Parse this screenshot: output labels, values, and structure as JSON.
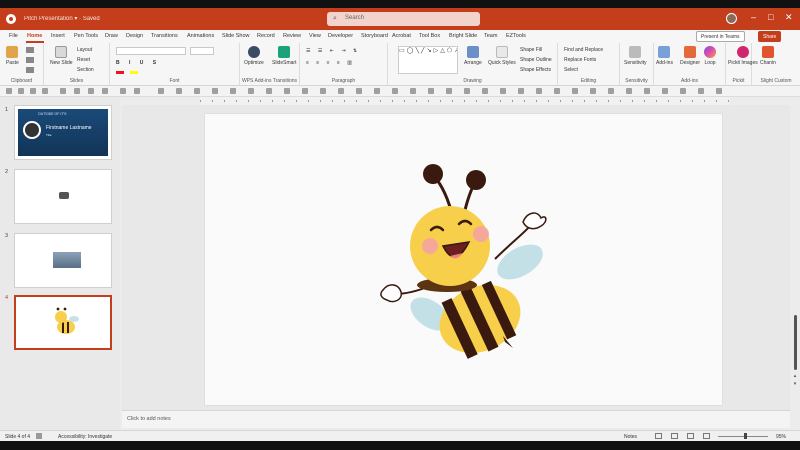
{
  "titlebar": {
    "doc_title": "Pitch Presentation ▾  ·  Saved",
    "search_placeholder": "Search",
    "search_icon": "search-icon",
    "minimize": "–",
    "maximize": "□",
    "close": "✕"
  },
  "menu": {
    "tabs": [
      "File",
      "Home",
      "Insert",
      "Pen Tools",
      "Draw",
      "Design",
      "Transitions",
      "Animations",
      "Slide Show",
      "Record",
      "Review",
      "View",
      "Developer",
      "Storyboard",
      "Acrobat",
      "Tool Box",
      "Bright Slide",
      "Team",
      "EZTools"
    ],
    "active_tab": "Home",
    "present_button": "Present in Teams",
    "share_button": "Share"
  },
  "ribbon": {
    "clipboard": {
      "paste": "Paste",
      "label": "Clipboard"
    },
    "slides": {
      "new_slide": "New Slide",
      "layout": "Layout",
      "reset": "Reset",
      "section": "Section",
      "label": "Slides"
    },
    "font": {
      "label": "Font"
    },
    "paragraph": {
      "label": "Paragraph"
    },
    "addins": {
      "label": "WPS Add-ins  Transitions"
    },
    "optimize": {
      "label": "Optimize"
    },
    "slidesmart": {
      "label": "SlideSmart"
    },
    "drawing": {
      "arrange": "Arrange",
      "quick_styles": "Quick Styles",
      "shape_fill": "Shape Fill",
      "shape_outline": "Shape Outline",
      "shape_effects": "Shape Effects",
      "label": "Drawing"
    },
    "editing": {
      "find_replace": "Find and Replace",
      "replace_fonts": "Replace Fonts",
      "select": "Select",
      "label": "Editing"
    },
    "sensitivity": {
      "button": "Sensitivity",
      "label": "Sensitivity"
    },
    "addin_btn": {
      "button": "Add-ins",
      "label": "Add-ins"
    },
    "designer": {
      "button": "Designer"
    },
    "loop": {
      "button": "Loop"
    },
    "pickit": {
      "button": "Pickit Images",
      "label": "Pickit"
    },
    "chanin": {
      "button": "Chanin",
      "label": "Slight Custom"
    }
  },
  "thumbnails": [
    {
      "number": "1",
      "title": "OUTSIDE OF IT'S",
      "name": "Firstname Lastname",
      "role": "Title",
      "selected": false
    },
    {
      "number": "2",
      "selected": false
    },
    {
      "number": "3",
      "selected": false
    },
    {
      "number": "4",
      "selected": true
    }
  ],
  "notes_placeholder": "Click to add notes",
  "status": {
    "slide_info": "Slide 4 of 4",
    "accessibility": "Accessibility: Investigate",
    "notes": "Notes",
    "zoom": "95%"
  },
  "colors": {
    "accent": "#c43e1c",
    "bee_yellow": "#f7cf4a",
    "bee_stripe": "#3a1a0e",
    "wing": "#b8dbe2"
  }
}
